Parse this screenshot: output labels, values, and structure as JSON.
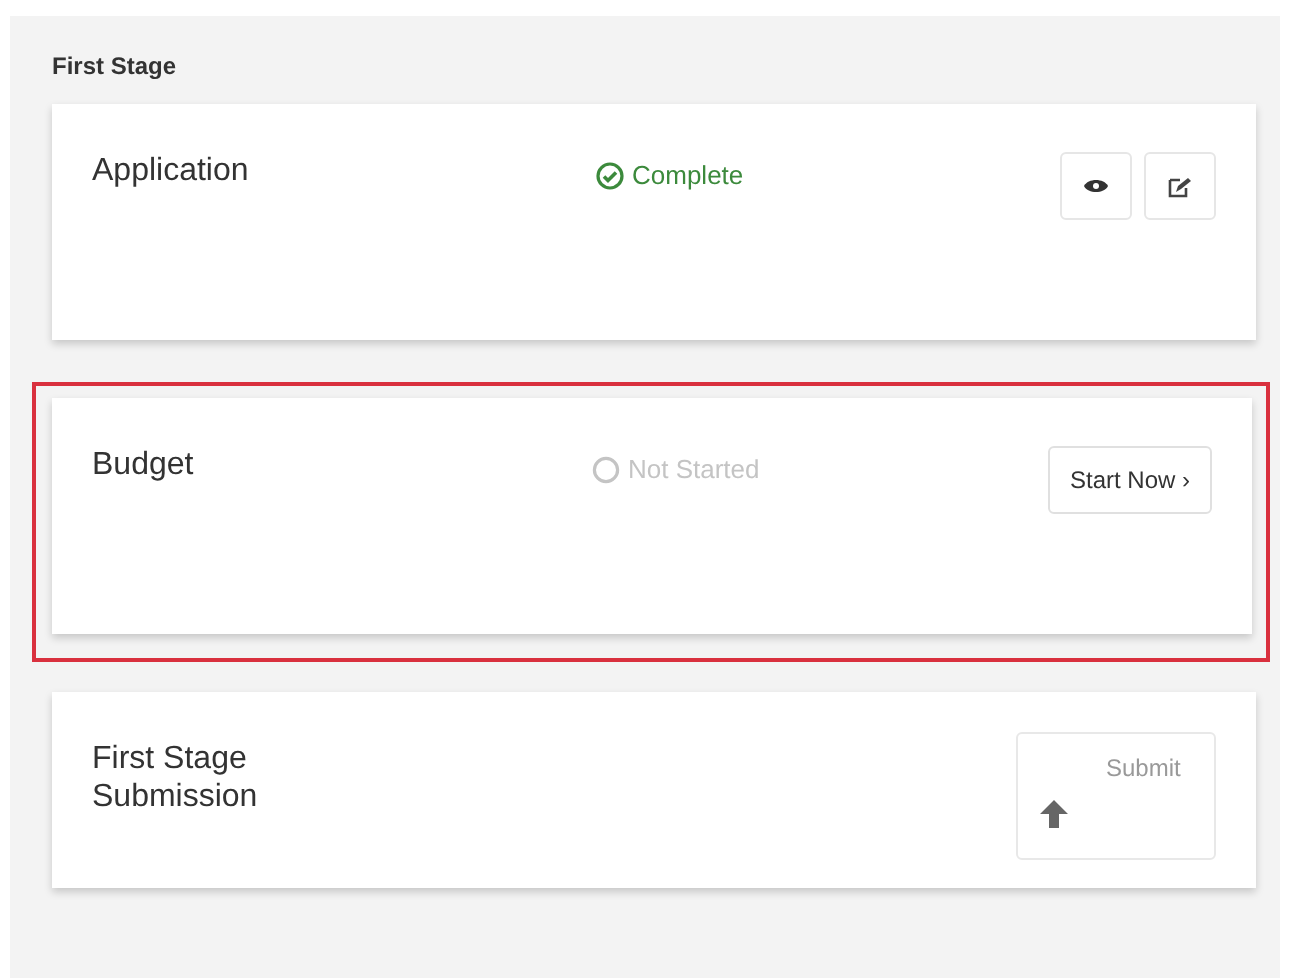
{
  "section": {
    "title": "First Stage"
  },
  "cards": [
    {
      "kind": "task",
      "title": "Application",
      "highlighted": false,
      "status": {
        "kind": "complete",
        "label": "Complete"
      },
      "actions": [
        {
          "kind": "view"
        },
        {
          "kind": "edit"
        }
      ]
    },
    {
      "kind": "task",
      "title": "Budget",
      "highlighted": true,
      "status": {
        "kind": "not_started",
        "label": "Not Started"
      },
      "start_button": "Start Now ›"
    },
    {
      "kind": "submit",
      "title": "First Stage Submission",
      "highlighted": false,
      "submit_button": {
        "label": "Submit",
        "disabled": true
      }
    }
  ]
}
